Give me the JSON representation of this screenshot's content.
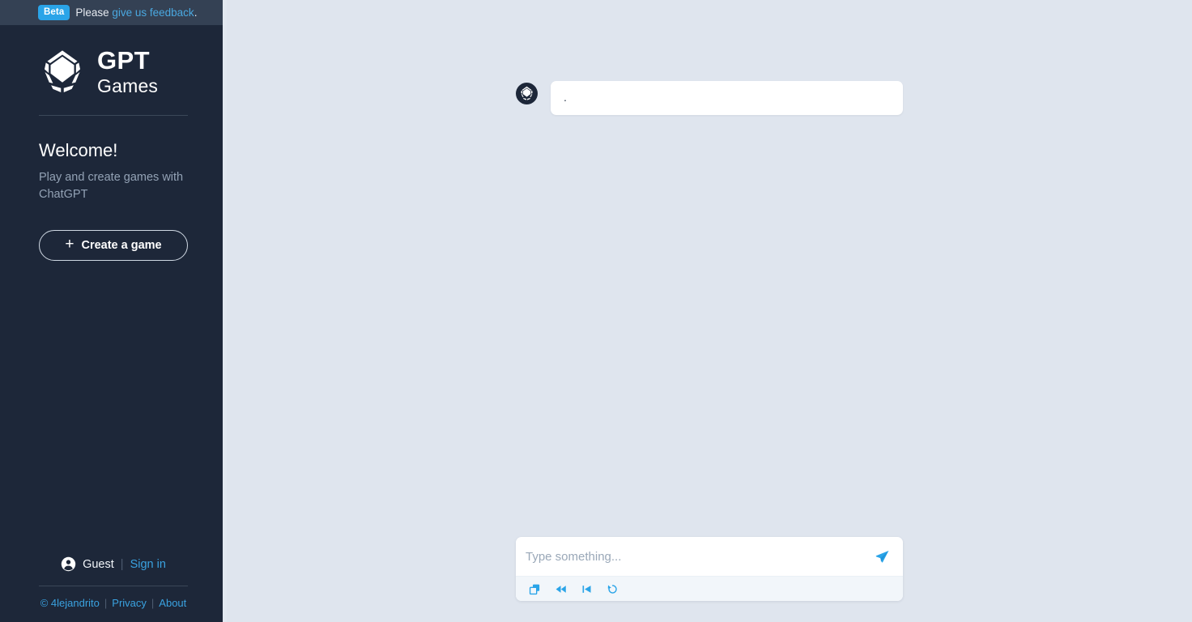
{
  "beta_bar": {
    "badge": "Beta",
    "text": "Please ",
    "link": "give us feedback",
    "period": "."
  },
  "sidebar": {
    "brand": {
      "logo_icon": "polygon-logo-icon",
      "line1": "GPT",
      "line2": "Games"
    },
    "welcome": {
      "title": "Welcome!",
      "subtitle": "Play and create games with ChatGPT"
    },
    "create_button": {
      "plus_icon": "plus-icon",
      "label": "Create a game"
    },
    "account": {
      "avatar_icon": "user-circle-icon",
      "name": "Guest",
      "separator": "|",
      "signin_label": "Sign in"
    },
    "footer": {
      "copyright": "© 4lejandrito",
      "sep1": "|",
      "privacy": "Privacy",
      "sep2": "|",
      "about": "About"
    }
  },
  "main": {
    "messages": [
      {
        "avatar_icon": "polygon-logo-icon",
        "text": "."
      }
    ],
    "composer": {
      "placeholder": "Type something...",
      "value": "",
      "send_icon": "send-paper-plane-icon",
      "tools": [
        {
          "icon": "copy-icon",
          "name": "copy-button"
        },
        {
          "icon": "rewind-icon",
          "name": "rewind-button"
        },
        {
          "icon": "step-back-icon",
          "name": "step-back-button"
        },
        {
          "icon": "restart-icon",
          "name": "restart-button"
        }
      ]
    }
  },
  "colors": {
    "sidebar_bg": "#1d2739",
    "topbar_bg": "#344154",
    "main_bg": "#dfe5ee",
    "accent": "#2aa4e8",
    "link": "#3aa2e0"
  }
}
